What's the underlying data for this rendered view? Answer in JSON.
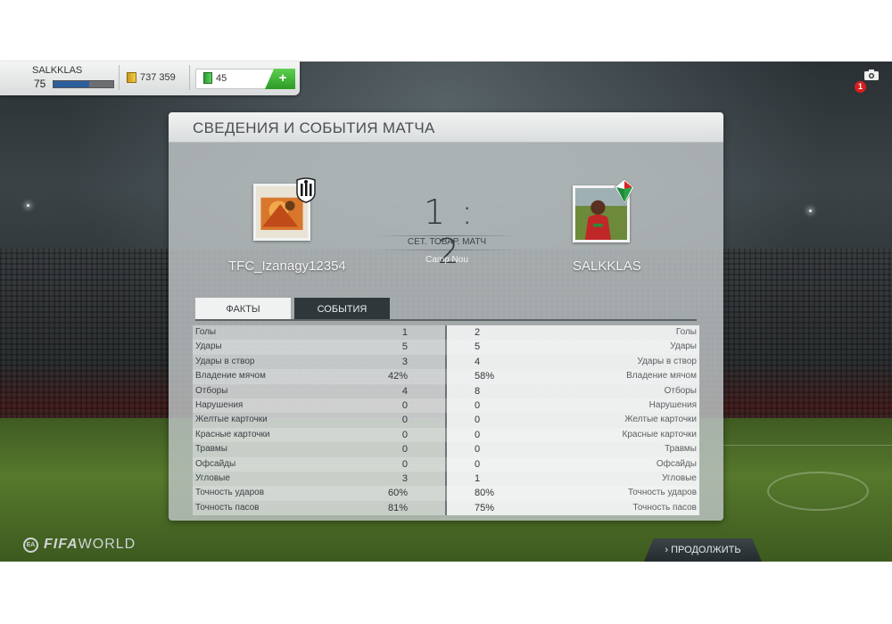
{
  "hud": {
    "player_name": "SALKKLAS",
    "level": "75",
    "xp_progress": 0.6,
    "coins": "737 359",
    "points": "45",
    "plus_label": "+"
  },
  "notifications": {
    "count": "1"
  },
  "panel": {
    "title": "СВЕДЕНИЯ И СОБЫТИЯ МАТЧА",
    "home_team": "TFC_Izanagy12354",
    "away_team": "SALKKLAS",
    "score": "1 : 2",
    "match_type": "СЕТ. ТОВАР. МАТЧ",
    "stadium": "Camp Nou",
    "tabs": [
      {
        "label": "ФАКТЫ",
        "active": true
      },
      {
        "label": "СОБЫТИЯ",
        "active": false
      }
    ],
    "stats": [
      {
        "label": "Голы",
        "home": "1",
        "away": "2"
      },
      {
        "label": "Удары",
        "home": "5",
        "away": "5"
      },
      {
        "label": "Удары в створ",
        "home": "3",
        "away": "4"
      },
      {
        "label": "Владение мячом",
        "home": "42%",
        "away": "58%"
      },
      {
        "label": "Отборы",
        "home": "4",
        "away": "8"
      },
      {
        "label": "Нарушения",
        "home": "0",
        "away": "0"
      },
      {
        "label": "Желтые карточки",
        "home": "0",
        "away": "0"
      },
      {
        "label": "Красные карточки",
        "home": "0",
        "away": "0"
      },
      {
        "label": "Травмы",
        "home": "0",
        "away": "0"
      },
      {
        "label": "Офсайды",
        "home": "0",
        "away": "0"
      },
      {
        "label": "Угловые",
        "home": "3",
        "away": "1"
      },
      {
        "label": "Точность ударов",
        "home": "60%",
        "away": "80%"
      },
      {
        "label": "Точность пасов",
        "home": "81%",
        "away": "75%"
      }
    ]
  },
  "footer": {
    "logo_ea": "EA",
    "logo_fifa": "FIFA",
    "logo_world": "WORLD",
    "continue_label": "› ПРОДОЛЖИТЬ"
  },
  "colors": {
    "accent_green": "#2c9a27",
    "xp_blue": "#2c5e9c",
    "notif_red": "#d71e1e",
    "tab_dark": "#2f373b"
  }
}
